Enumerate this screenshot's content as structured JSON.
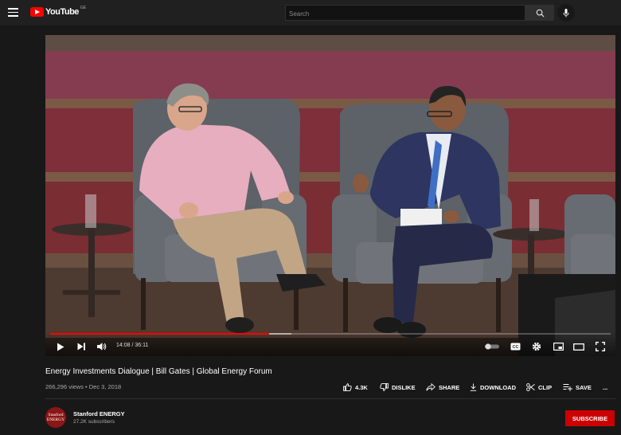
{
  "header": {
    "logo_text": "YouTube",
    "country_code": "GE",
    "search_placeholder": "Search"
  },
  "player": {
    "time_current": "14:08",
    "time_separator": " / ",
    "time_total": "36:11",
    "progress_fraction": 0.39,
    "buffer_fraction": 0.43,
    "progress_color": "#ff0000"
  },
  "video": {
    "title": "Energy Investments Dialogue | Bill Gates | Global Energy Forum",
    "views": "266,296 views",
    "date_separator": " • ",
    "date": "Dec 3, 2018"
  },
  "actions": {
    "like": "4.3K",
    "dislike": "DISLIKE",
    "share": "SHARE",
    "download": "DOWNLOAD",
    "clip": "CLIP",
    "save": "SAVE",
    "more": "..."
  },
  "channel": {
    "avatar_line1": "Stanford",
    "avatar_line2": "ENERGY",
    "name": "Stanford ENERGY",
    "subscribers": "27.2K subscribers",
    "subscribe_label": "SUBSCRIBE",
    "brand_color": "#8c1515"
  },
  "theme": {
    "background": "#181818",
    "topbar": "#202020",
    "subscribe_red": "#cc0000"
  }
}
